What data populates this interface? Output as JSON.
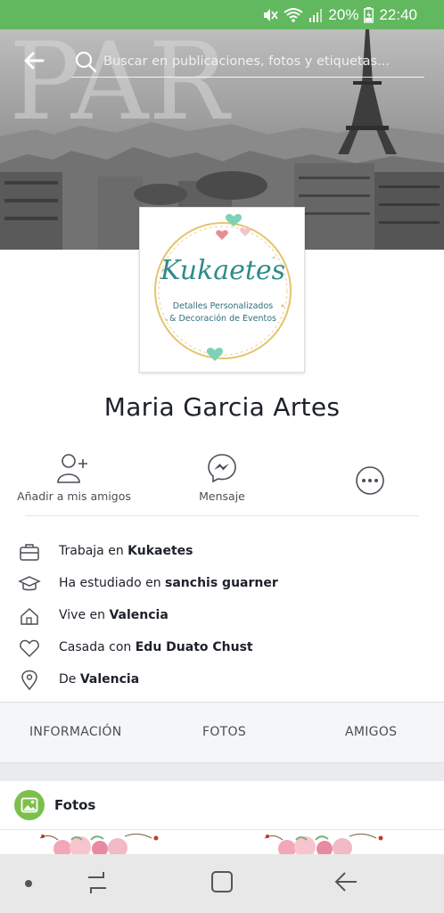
{
  "status_bar": {
    "battery": "20%",
    "time": "22:40",
    "icons": [
      "mute-icon",
      "wifi-icon",
      "signal-icon",
      "battery-icon"
    ]
  },
  "header": {
    "search_placeholder": "Buscar en publicaciones, fotos y etiquetas...",
    "back_icon": "arrow-left-icon"
  },
  "profile": {
    "name": "Maria Garcia Artes",
    "picture": {
      "brand": "Kukaetes",
      "tagline_1": "Detalles Personalizados",
      "tagline_2": "& Decoración de Eventos"
    }
  },
  "actions": [
    {
      "label": "Añadir a mis amigos",
      "icon": "add-friend-icon"
    },
    {
      "label": "Mensaje",
      "icon": "messenger-icon"
    },
    {
      "label": "",
      "icon": "more-icon"
    }
  ],
  "info": [
    {
      "prefix": "Trabaja en ",
      "value": "Kukaetes",
      "icon": "briefcase-icon"
    },
    {
      "prefix": "Ha estudiado en ",
      "value": "sanchis guarner",
      "icon": "graduation-cap-icon"
    },
    {
      "prefix": "Vive en ",
      "value": "Valencia",
      "icon": "home-icon"
    },
    {
      "prefix": "Casada con ",
      "value": "Edu Duato Chust",
      "icon": "heart-icon"
    },
    {
      "prefix": "De ",
      "value": "Valencia",
      "icon": "location-pin-icon"
    }
  ],
  "tabs": [
    "INFORMACIÓN",
    "FOTOS",
    "AMIGOS"
  ],
  "photos": {
    "title": "Fotos",
    "icon": "photo-icon"
  },
  "nav_bar": {
    "icons": [
      "dot-icon",
      "recent-apps-icon",
      "home-square-icon",
      "back-icon"
    ]
  },
  "colors": {
    "status_bar": "#62b85f",
    "text": "#1d2129",
    "muted_text": "#4b4f56",
    "teal": "#2e8b8b",
    "photos_badge": "#7cc04b"
  }
}
